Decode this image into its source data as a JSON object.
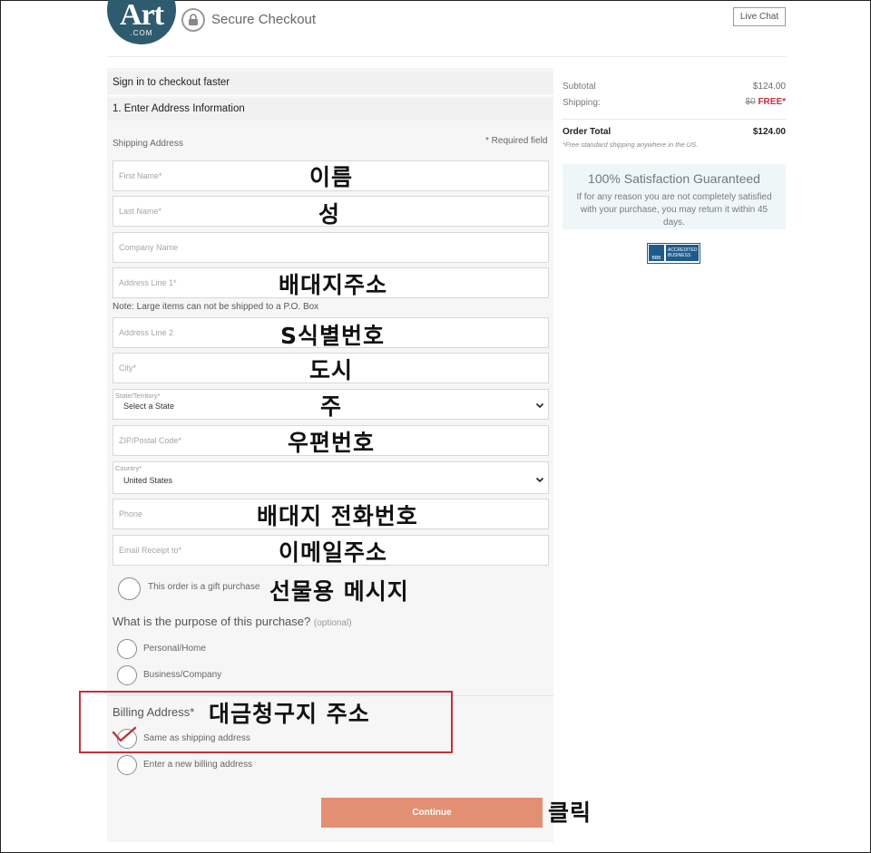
{
  "header": {
    "logo_main": "Art",
    "logo_sub": ".COM",
    "title": "Secure Checkout",
    "live_chat": "Live Chat"
  },
  "checkout": {
    "sign_in": "Sign in to checkout faster",
    "step1": "1. Enter Address Information",
    "shipping_label": "Shipping Address",
    "required_note": "* Required field",
    "fields": {
      "first_name": {
        "placeholder": "First Name*",
        "annotation": "이름"
      },
      "last_name": {
        "placeholder": "Last Name*",
        "annotation": "성"
      },
      "company": {
        "placeholder": "Company Name"
      },
      "address1": {
        "placeholder": "Address Line 1*",
        "annotation": "배대지주소"
      },
      "address2": {
        "placeholder": "Address Line 2",
        "annotation": "S식별번호"
      },
      "city": {
        "placeholder": "City*",
        "annotation": "도시"
      },
      "state": {
        "label": "State/Territory*",
        "value": "Select a State",
        "annotation": "주"
      },
      "zip": {
        "placeholder": "ZIP/Postal Code*",
        "annotation": "우편번호"
      },
      "country": {
        "label": "Country*",
        "value": "United States"
      },
      "phone": {
        "placeholder": "Phone",
        "annotation": "배대지 전화번호"
      },
      "email": {
        "placeholder": "Email Receipt to*",
        "annotation": "이메일주소"
      }
    },
    "po_box_note": "Note: Large items can not be shipped to a P.O. Box",
    "gift": {
      "label": "This order is a gift purchase",
      "annotation": "선물용 메시지"
    },
    "purpose": {
      "question": "What is the purpose of this purchase?",
      "optional": "(optional)",
      "options": [
        "Personal/Home",
        "Business/Company"
      ]
    },
    "billing": {
      "label": "Billing Address*",
      "annotation": "대금청구지 주소",
      "options": [
        "Same as shipping address",
        "Enter a new billing address"
      ]
    },
    "continue_label": "Continue",
    "continue_annotation": "클릭"
  },
  "summary": {
    "subtotal_label": "Subtotal",
    "subtotal_value": "$124.00",
    "shipping_label": "Shipping:",
    "shipping_old": "$0",
    "shipping_value": "FREE*",
    "total_label": "Order Total",
    "total_value": "$124.00",
    "free_note": "*Free standard shipping anywhere in the US.",
    "guarantee_title": "100% Satisfaction Guaranteed",
    "guarantee_text": "If for any reason you are not completely satisfied with your purchase, you may return it within 45 days.",
    "bbb_seal": "BBB",
    "bbb_line1": "ACCREDITED",
    "bbb_line2": "BUSINESS"
  },
  "colors": {
    "accent": "#e28f73",
    "annotation_box": "#c0323e",
    "logo": "#2f5b6e"
  }
}
